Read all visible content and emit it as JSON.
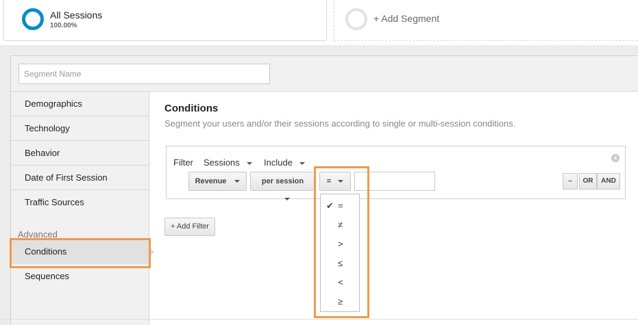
{
  "segments": {
    "active": {
      "title": "All Sessions",
      "percent": "100.00%",
      "ring_color": "#058dc7"
    },
    "add_label": "+ Add Segment"
  },
  "editor": {
    "segment_name_placeholder": "Segment Name",
    "nav": {
      "items": [
        "Demographics",
        "Technology",
        "Behavior",
        "Date of First Session",
        "Traffic Sources"
      ],
      "advanced_heading": "Advanced",
      "advanced_items": [
        "Conditions",
        "Sequences"
      ],
      "selected": "Conditions"
    },
    "main": {
      "title": "Conditions",
      "description": "Segment your users and/or their sessions according to single or multi-session conditions.",
      "filter": {
        "label": "Filter",
        "scope": "Sessions",
        "mode": "Include",
        "dimension": "Revenue",
        "per": "per session",
        "operator": "=",
        "value": "",
        "minus": "–",
        "or": "OR",
        "and": "AND"
      },
      "add_filter": "+ Add Filter",
      "operator_options": [
        "=",
        "≠",
        ">",
        "≤",
        "<",
        "≥"
      ],
      "selected_operator": "=",
      "check_mark": "✔"
    }
  },
  "highlight_color": "#f09a4a"
}
